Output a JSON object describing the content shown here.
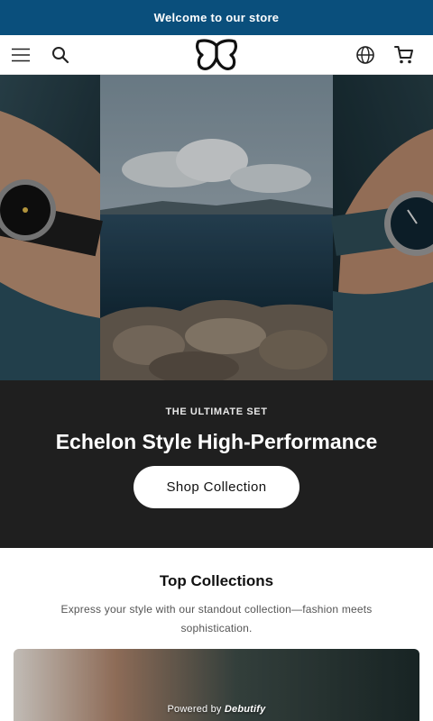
{
  "announcement": {
    "text": "Welcome to our store"
  },
  "header": {
    "icons": [
      "menu-icon",
      "search-icon",
      "logo",
      "globe-icon",
      "cart-icon"
    ]
  },
  "hero": {
    "eyebrow": "THE ULTIMATE SET",
    "title": "Echelon Style High-Performance",
    "cta_label": "Shop Collection"
  },
  "collections": {
    "title": "Top Collections",
    "description": "Express your style with our standout collection—fashion meets sophistication."
  },
  "footer_badge": {
    "prefix": "Powered by",
    "brand": "Debutify"
  },
  "colors": {
    "announcement_bg": "#0a4f7c",
    "hero_panel_bg": "#1f1f1f",
    "cta_bg": "#ffffff"
  }
}
